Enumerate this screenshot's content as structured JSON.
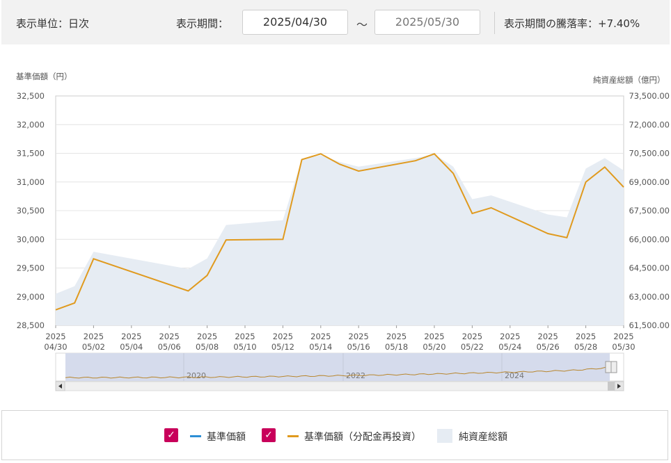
{
  "controls": {
    "unit_label": "表示単位：日次",
    "period_label": "表示期間：",
    "start_date": "2025/04/30",
    "tilde": "～",
    "end_date": "2025/05/30",
    "change_label": "表示期間の騰落率：+7.40%"
  },
  "chart_data": {
    "type": "line",
    "left_axis_title": "基準価額（円）",
    "right_axis_title": "純資産総額（億円）",
    "left_ticks": [
      "32,500",
      "32,000",
      "31,500",
      "31,000",
      "30,500",
      "30,000",
      "29,500",
      "29,000",
      "28,500"
    ],
    "right_ticks": [
      "73,500.00",
      "72,000.00",
      "70,500.00",
      "69,000.00",
      "67,500.00",
      "66,000.00",
      "64,500.00",
      "63,000.00",
      "61,500.00"
    ],
    "ylim_left": [
      28500,
      32500
    ],
    "ylim_right": [
      61500,
      73500
    ],
    "x_ticks": [
      {
        "year": "2025",
        "md": "04/30"
      },
      {
        "year": "2025",
        "md": "05/02"
      },
      {
        "year": "2025",
        "md": "05/04"
      },
      {
        "year": "2025",
        "md": "05/06"
      },
      {
        "year": "2025",
        "md": "05/08"
      },
      {
        "year": "2025",
        "md": "05/10"
      },
      {
        "year": "2025",
        "md": "05/12"
      },
      {
        "year": "2025",
        "md": "05/14"
      },
      {
        "year": "2025",
        "md": "05/16"
      },
      {
        "year": "2025",
        "md": "05/18"
      },
      {
        "year": "2025",
        "md": "05/20"
      },
      {
        "year": "2025",
        "md": "05/22"
      },
      {
        "year": "2025",
        "md": "05/24"
      },
      {
        "year": "2025",
        "md": "05/26"
      },
      {
        "year": "2025",
        "md": "05/28"
      },
      {
        "year": "2025",
        "md": "05/30"
      }
    ],
    "series": [
      {
        "name": "基準価額（分配金再投資）",
        "color": "#e09a1e",
        "axis": "left",
        "x": [
          "2025-04-30",
          "2025-05-01",
          "2025-05-02",
          "2025-05-07",
          "2025-05-08",
          "2025-05-09",
          "2025-05-12",
          "2025-05-13",
          "2025-05-14",
          "2025-05-15",
          "2025-05-16",
          "2025-05-19",
          "2025-05-20",
          "2025-05-21",
          "2025-05-22",
          "2025-05-23",
          "2025-05-26",
          "2025-05-27",
          "2025-05-28",
          "2025-05-29",
          "2025-05-30"
        ],
        "values": [
          28770,
          28890,
          29660,
          29100,
          29370,
          29990,
          30000,
          31390,
          31490,
          31310,
          31190,
          31370,
          31490,
          31150,
          30450,
          30550,
          30100,
          30030,
          31000,
          31260,
          30910
        ]
      },
      {
        "name": "純資産総額",
        "color": "#e6ecf3",
        "axis": "right",
        "x": [
          "2025-04-30",
          "2025-05-01",
          "2025-05-02",
          "2025-05-07",
          "2025-05-08",
          "2025-05-09",
          "2025-05-12",
          "2025-05-13",
          "2025-05-14",
          "2025-05-15",
          "2025-05-16",
          "2025-05-19",
          "2025-05-20",
          "2025-05-21",
          "2025-05-22",
          "2025-05-23",
          "2025-05-26",
          "2025-05-27",
          "2025-05-28",
          "2025-05-29",
          "2025-05-30"
        ],
        "values": [
          63150,
          63550,
          65350,
          64450,
          65000,
          66750,
          67000,
          70200,
          70400,
          70050,
          69800,
          70250,
          70450,
          69800,
          68100,
          68300,
          67300,
          67150,
          69700,
          70250,
          69600
        ]
      }
    ],
    "navigator": {
      "year_labels": [
        "2020",
        "2022",
        "2024"
      ]
    }
  },
  "legend": {
    "item1": "基準価額",
    "item1_color": "#2d8fd5",
    "item2": "基準価額（分配金再投資）",
    "item2_color": "#e09a1e",
    "item3": "純資産総額",
    "check_glyph": "✓"
  }
}
